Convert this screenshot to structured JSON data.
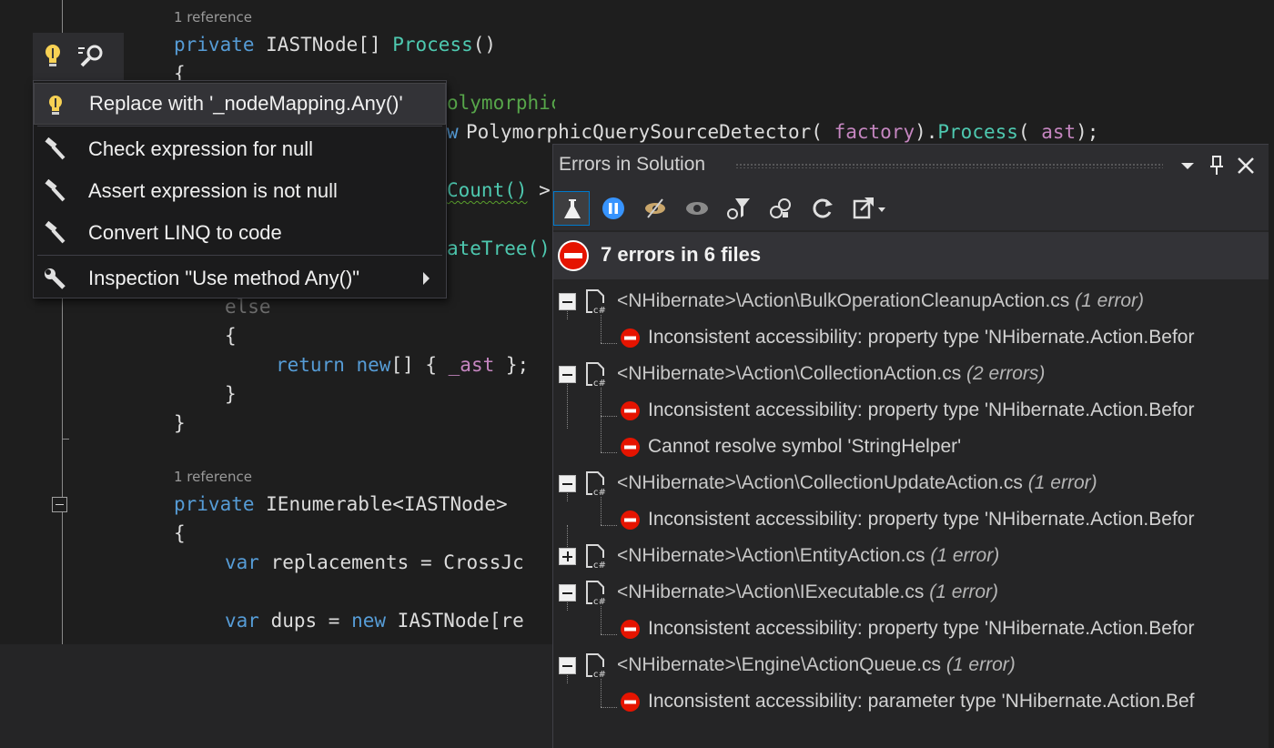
{
  "editor": {
    "lens_1": "1 reference",
    "lens_2": "1 reference",
    "lines": {
      "l1_kw": "private",
      "l1_ty": " IASTNode[] ",
      "l1_fn": "Process",
      "l1_end": "()",
      "l2": "{",
      "l3_cm": "olymorphic query sources",
      "l4_pre": "w ",
      "l4_ty": "PolymorphicQuerySourceDetector(",
      "l4_arg1": " factory",
      "l4_mid": ").",
      "l4_fn": "Process",
      "l4_open": "(",
      "l4_arg2": " ast",
      "l4_end": ");",
      "l5_sq": "Count()",
      "l5_end": " >",
      "l6": "ateTree()",
      "l7": "else",
      "l8": "{",
      "l9_kw1": "return",
      "l9_kw2": " new",
      "l9_mid": "[] { ",
      "l9_fld": "_ast",
      "l9_end": " };",
      "l10": "}",
      "l11": "}",
      "l12_kw": "private",
      "l12_ty": " IEnumerable<IASTNode>",
      "l13": "{",
      "l14_kw": "var",
      "l14_rest": " replacements = CrossJc",
      "l15_kw": "var",
      "l15_mid": " dups = ",
      "l15_kw2": "new",
      "l15_rest": " IASTNode[re"
    }
  },
  "quick_actions": {
    "bulb_icon": "light-bulb-icon",
    "search_icon": "search-icon",
    "items": [
      {
        "label": "Replace with '_nodeMapping.Any()'",
        "icon": "light-bulb-icon"
      },
      {
        "label": "Check expression for null",
        "icon": "hammer-icon"
      },
      {
        "label": "Assert expression is not null",
        "icon": "hammer-icon"
      },
      {
        "label": "Convert LINQ to code",
        "icon": "hammer-icon"
      },
      {
        "label": "Inspection \"Use method Any()\"",
        "icon": "wrench-icon"
      }
    ]
  },
  "errors_panel": {
    "title": "Errors in Solution",
    "summary": "7 errors in 6 files",
    "colors": {
      "error": "#e51400",
      "accent": "#007acc"
    },
    "toolbar": [
      "flask-icon",
      "pause-icon",
      "eye-off-icon",
      "eye-icon",
      "filter-icon",
      "group-icon",
      "refresh-icon",
      "export-icon"
    ],
    "files": [
      {
        "path": "<NHibernate>\\Action\\BulkOperationCleanupAction.cs",
        "count": "(1 error)",
        "expanded": true,
        "errors": [
          "Inconsistent accessibility: property type 'NHibernate.Action.Befor"
        ]
      },
      {
        "path": "<NHibernate>\\Action\\CollectionAction.cs",
        "count": "(2 errors)",
        "expanded": true,
        "errors": [
          "Inconsistent accessibility: property type 'NHibernate.Action.Befor",
          "Cannot resolve symbol 'StringHelper'"
        ]
      },
      {
        "path": "<NHibernate>\\Action\\CollectionUpdateAction.cs",
        "count": "(1 error)",
        "expanded": true,
        "errors": [
          "Inconsistent accessibility: property type 'NHibernate.Action.Befor"
        ]
      },
      {
        "path": "<NHibernate>\\Action\\EntityAction.cs",
        "count": "(1 error)",
        "expanded": false,
        "errors": []
      },
      {
        "path": "<NHibernate>\\Action\\IExecutable.cs",
        "count": "(1 error)",
        "expanded": true,
        "errors": [
          "Inconsistent accessibility: property type 'NHibernate.Action.Befor"
        ]
      },
      {
        "path": "<NHibernate>\\Engine\\ActionQueue.cs",
        "count": "(1 error)",
        "expanded": true,
        "errors": [
          "Inconsistent accessibility: parameter type 'NHibernate.Action.Bef"
        ]
      }
    ]
  }
}
